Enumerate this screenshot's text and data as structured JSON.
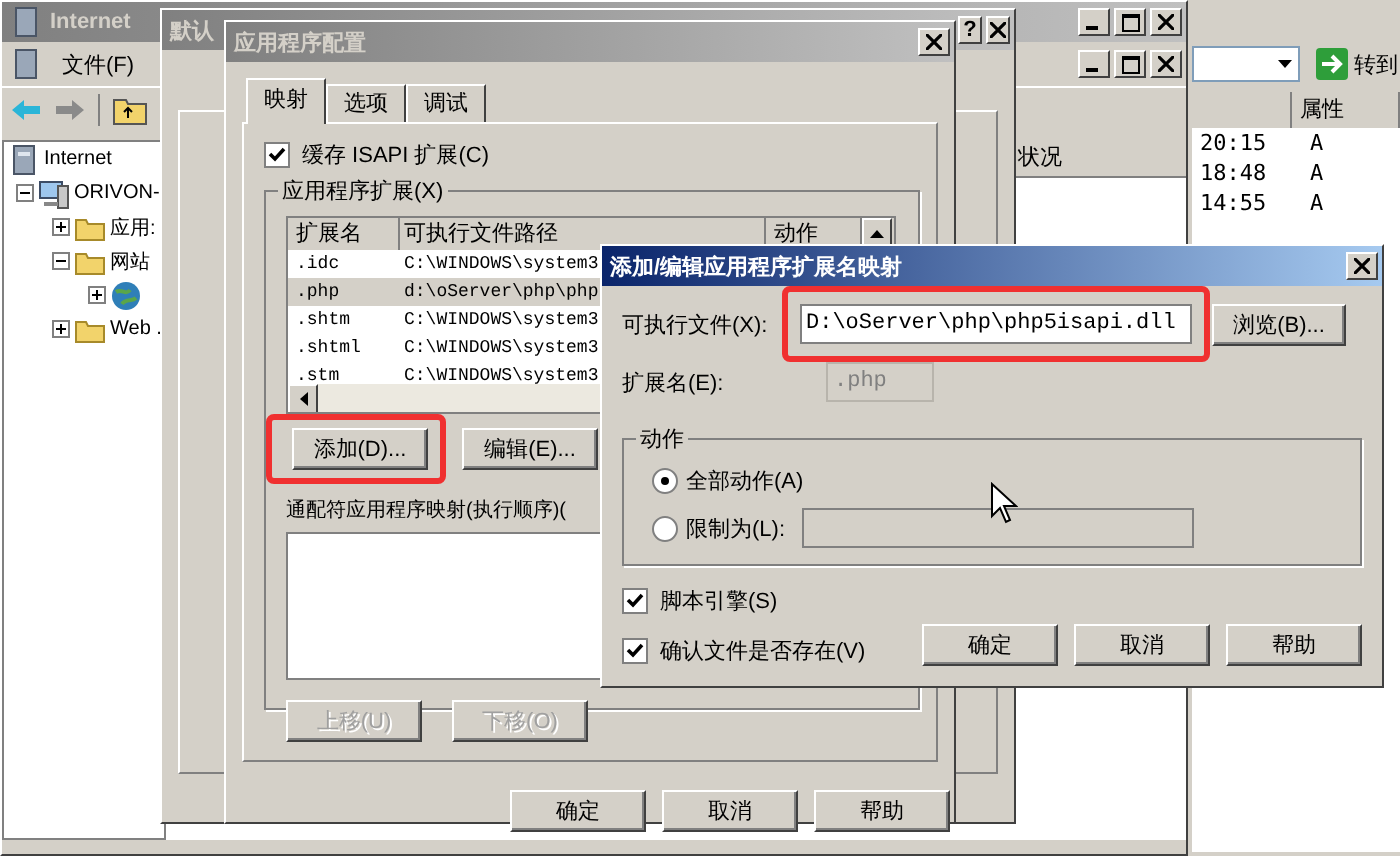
{
  "mmc_window": {
    "title": "Internet",
    "menu": [
      "文件(F)"
    ],
    "tree": [
      {
        "label": "Internet",
        "kind": "root",
        "children": [
          {
            "label": "ORIVON-",
            "kind": "computer",
            "expanded": true,
            "children": [
              {
                "label": "应用:",
                "kind": "folder",
                "expanded": false
              },
              {
                "label": "网站",
                "kind": "folder",
                "expanded": true,
                "children": [
                  {
                    "kind": "site",
                    "expanded": false
                  }
                ]
              },
              {
                "label": "Web .",
                "kind": "folder",
                "expanded": false
              }
            ]
          }
        ]
      }
    ],
    "result_columns": [
      "状况"
    ]
  },
  "explorer_window": {
    "go_button": "转到",
    "columns": [
      "属性"
    ],
    "rows": [
      {
        "column_1": "20:15",
        "column_2": "A"
      },
      {
        "column_1": "18:48",
        "column_2": "A"
      },
      {
        "column_1": "14:55",
        "column_2": "A"
      }
    ]
  },
  "properties_dialog": {
    "title": "默认",
    "help_glyph": "?"
  },
  "app_config_dialog": {
    "title": "应用程序配置",
    "tabs": [
      {
        "label": "映射",
        "selected": true
      },
      {
        "label": "选项",
        "selected": false
      },
      {
        "label": "调试",
        "selected": false
      }
    ],
    "cache_checkbox": {
      "label": "缓存 ISAPI 扩展(C)",
      "checked": true
    },
    "extensions_group": "应用程序扩展(X)",
    "extensions_table": {
      "columns": [
        "扩展名",
        "可执行文件路径",
        "动作"
      ],
      "rows": [
        {
          "extension": ".idc",
          "path": "C:\\WINDOWS\\system3",
          "selected": false
        },
        {
          "extension": ".php",
          "path": "d:\\oServer\\php\\php",
          "selected": true
        },
        {
          "extension": ".shtm",
          "path": "C:\\WINDOWS\\system3",
          "selected": false
        },
        {
          "extension": ".shtml",
          "path": "C:\\WINDOWS\\system3",
          "selected": false
        },
        {
          "extension": ".stm",
          "path": "C:\\WINDOWS\\system3",
          "selected": false
        }
      ]
    },
    "add_button": {
      "label": "添加(D)...",
      "highlighted": true
    },
    "edit_button": {
      "label": "编辑(E)..."
    },
    "wildcard_label": "通配符应用程序映射(执行顺序)(",
    "move_buttons": [
      {
        "label": "上移(U)",
        "disabled": true
      },
      {
        "label": "下移(O)",
        "disabled": true
      }
    ],
    "buttons": [
      "确定",
      "取消",
      "帮助"
    ]
  },
  "add_edit_dialog": {
    "title": "添加/编辑应用程序扩展名映射",
    "executable_label": "可执行文件(X):",
    "executable_field": {
      "value": "D:\\oServer\\php\\php5isapi.dll",
      "highlighted": true
    },
    "browse_button": "浏览(B)...",
    "extension_label": "扩展名(E):",
    "extension_field": {
      "value": ".php",
      "disabled": true
    },
    "verbs_group": "动作",
    "verb_options": [
      {
        "label": "全部动作(A)",
        "selected": true
      },
      {
        "label": "限制为(L):",
        "selected": false
      }
    ],
    "limit_field": {
      "disabled": true
    },
    "checkboxes": [
      {
        "label": "脚本引擎(S)",
        "checked": true
      },
      {
        "label": "确认文件是否存在(V)",
        "checked": true
      }
    ],
    "buttons": [
      "确定",
      "取消",
      "帮助"
    ]
  }
}
